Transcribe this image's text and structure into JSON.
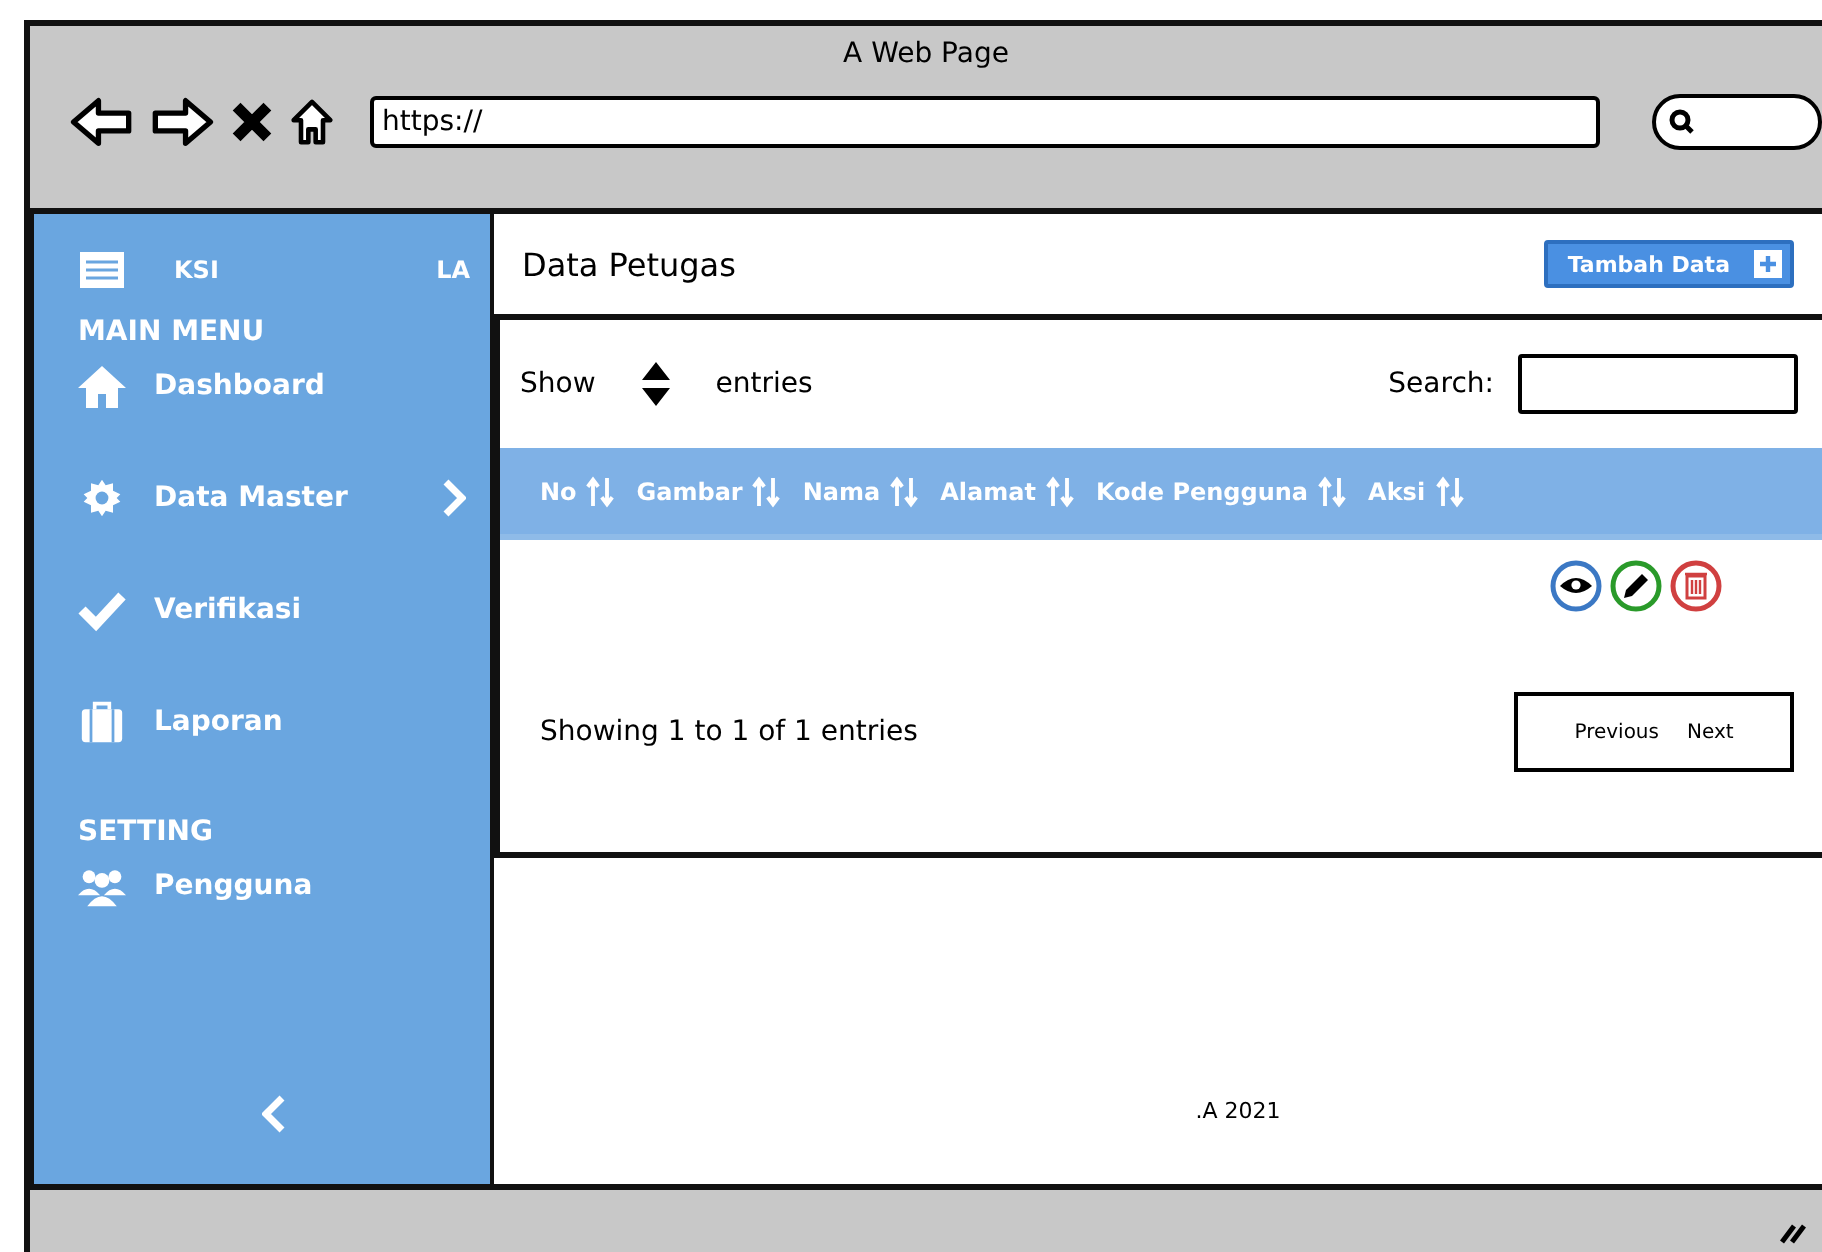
{
  "window": {
    "title": "A Web Page",
    "url": "https://"
  },
  "sidebar": {
    "brand": [
      "KSI",
      "LA"
    ],
    "sections": [
      {
        "heading": "MAIN MENU",
        "items": [
          {
            "kind": "home",
            "label": "Dashboard",
            "has_submenu": false
          },
          {
            "kind": "gear",
            "label": "Data Master",
            "has_submenu": true
          },
          {
            "kind": "check",
            "label": "Verifikasi",
            "has_submenu": false
          },
          {
            "kind": "case",
            "label": "Laporan",
            "has_submenu": false
          }
        ]
      },
      {
        "heading": "SETTING",
        "items": [
          {
            "kind": "users",
            "label": "Pengguna",
            "has_submenu": false
          }
        ]
      }
    ]
  },
  "page": {
    "title": "Data Petugas",
    "add_button": "Tambah Data"
  },
  "table": {
    "show_label": "Show",
    "entries_label": "entries",
    "search_label": "Search:",
    "columns": [
      {
        "label": "No"
      },
      {
        "label": "Gambar"
      },
      {
        "label": "Nama"
      },
      {
        "label": "Alamat"
      },
      {
        "label": "Kode Pengguna"
      },
      {
        "label": "Aksi"
      }
    ],
    "info": "Showing 1 to 1 of 1 entries",
    "pagination": [
      "Previous",
      "Next"
    ]
  },
  "footer": {
    "text": ".A 2021"
  }
}
